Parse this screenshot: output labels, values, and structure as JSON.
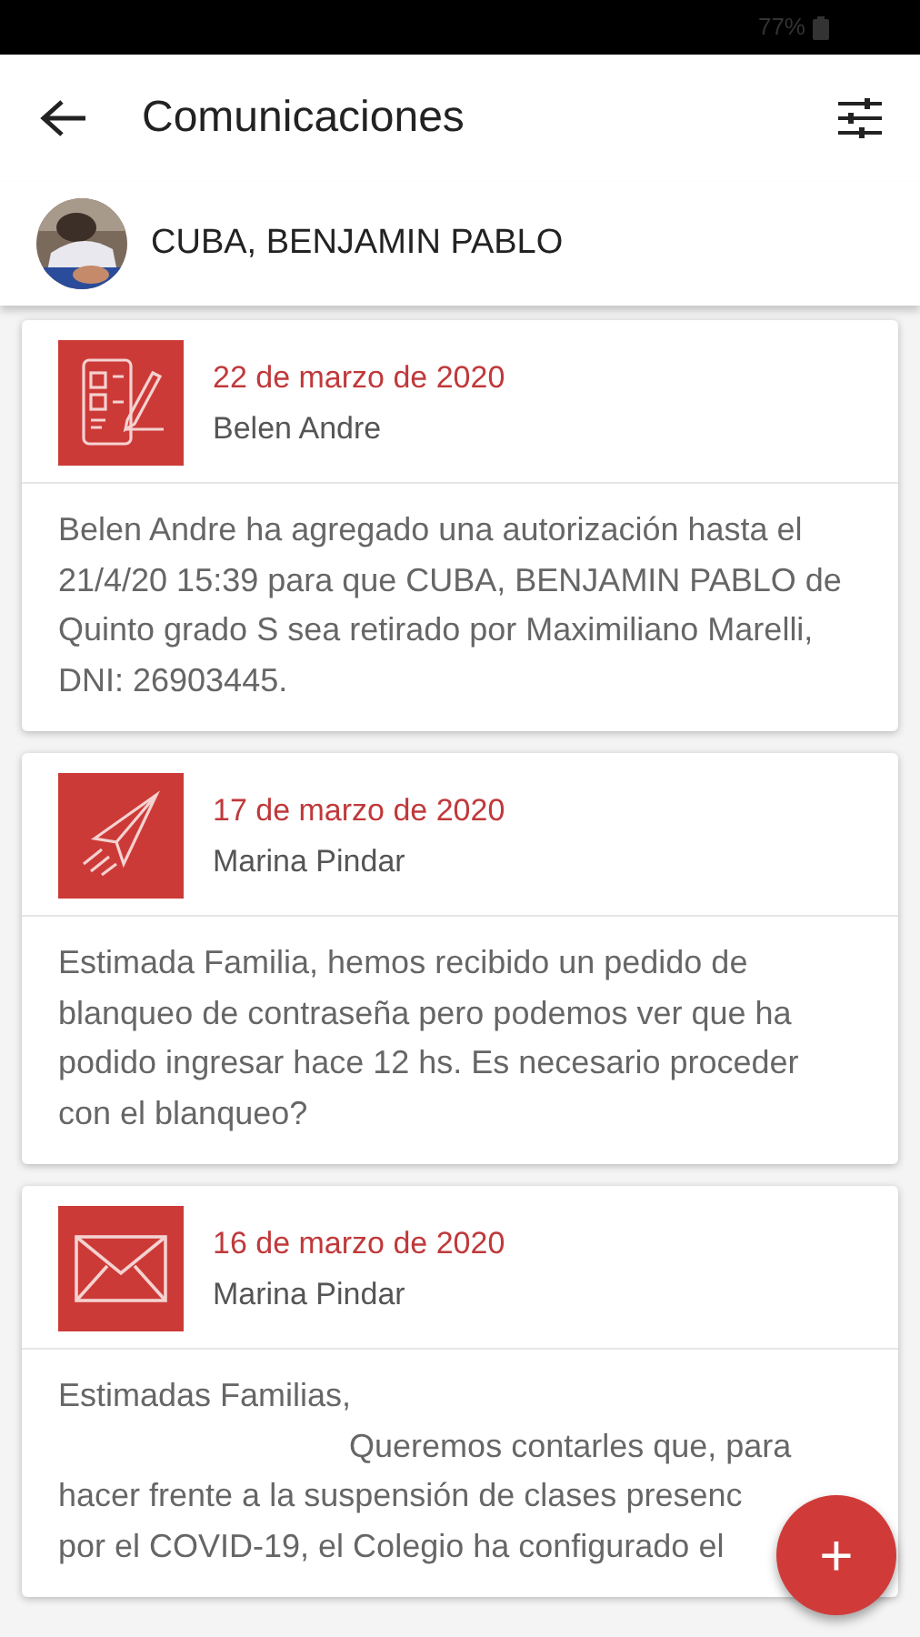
{
  "status_bar": {
    "battery": "77%"
  },
  "header": {
    "title": "Comunicaciones"
  },
  "student": {
    "name": "CUBA, BENJAMIN PABLO"
  },
  "messages": [
    {
      "kind": "authorization",
      "date": "22 de marzo de 2020",
      "author": "Belen Andre",
      "body": "Belen Andre ha agregado una autorización hasta el 21/4/20 15:39 para que CUBA, BENJAMIN PABLO de Quinto grado S sea retirado por Maximiliano Marelli, DNI: 26903445."
    },
    {
      "kind": "sent",
      "date": "17 de marzo de 2020",
      "author": "Marina Pindar",
      "body": "Estimada Familia, hemos recibido un pedido de blanqueo de contraseña pero podemos ver que ha podido ingresar hace 12 hs. Es necesario proceder con el blanqueo?"
    },
    {
      "kind": "mail",
      "date": "16 de marzo de 2020",
      "author": "Marina Pindar",
      "body": "Estimadas Familias,\n                                Queremos contarles que, para\nhacer frente a la suspensión de clases presenc\npor el COVID-19, el Colegio ha configurado el"
    }
  ],
  "fab": {
    "label": "+"
  }
}
